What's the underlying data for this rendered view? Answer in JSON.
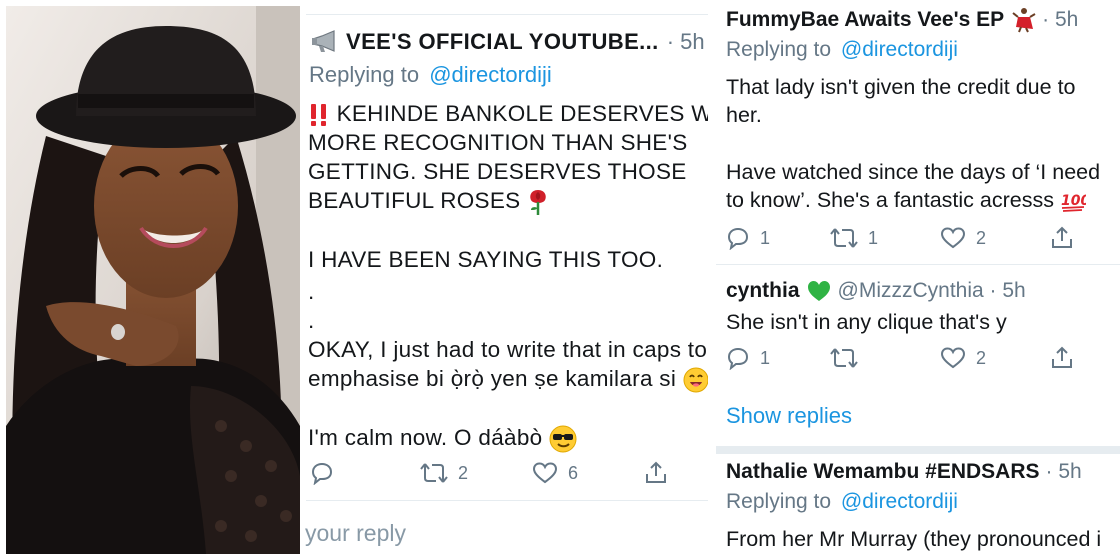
{
  "tweet_main": {
    "author_name": "VEE'S OFFICIAL YOUTUBE...",
    "time": "· 5h",
    "replying_prefix": "Replying to",
    "replying_handle": "@directordiji",
    "line1": "KEHINDE BANKOLE DESERVES WAY",
    "line2": "MORE RECOGNITION THAN SHE'S",
    "line3": "GETTING. SHE DESERVES THOSE",
    "line4": "BEAUTIFUL ROSES",
    "line5": "I HAVE BEEN SAYING THIS TOO.",
    "dot1": ".",
    "dot2": ".",
    "line6": "OKAY, I just had to write that in caps to",
    "line7": "emphasise bi ọ̀rọ̀ yen ṣe kamilara si",
    "line8": "I'm calm now. O dáàbò",
    "retweet_count": "2",
    "like_count": "6",
    "reply_placeholder": "your reply"
  },
  "reply1": {
    "author_name": "FummyBae Awaits Vee's EP",
    "time": "· 5h",
    "replying_prefix": "Replying to",
    "replying_handle": "@directordiji",
    "line1": "That lady isn't given the credit due to",
    "line2": "her.",
    "line3": "Have watched since the days of ‘I need",
    "line4": "to know’. She's a fantastic acresss",
    "reply_count": "1",
    "retweet_count": "1",
    "like_count": "2"
  },
  "reply2": {
    "author_name": "cynthia",
    "handle_time": "@MizzzCynthia · 5h",
    "line1": "She isn't in any clique that's y",
    "reply_count": "1",
    "like_count": "2"
  },
  "show_replies": "Show replies",
  "reply3": {
    "author_name": "Nathalie Wemambu #ENDSARS",
    "time": "· 5h",
    "replying_prefix": "Replying to",
    "replying_handle": "@directordiji",
    "line1": "From her Mr Murray (they pronounced i"
  },
  "colors": {
    "link": "#1b95e0",
    "muted": "#657786",
    "text": "#14171a",
    "divider": "#e6ecf0"
  },
  "icons": [
    "megaphone-icon",
    "double-exclamation-icon",
    "rose-icon",
    "smiling-face-icon",
    "sunglasses-face-icon",
    "dancer-icon",
    "green-heart-icon",
    "hundred-points-icon",
    "reply-icon",
    "retweet-icon",
    "like-icon",
    "share-icon"
  ]
}
